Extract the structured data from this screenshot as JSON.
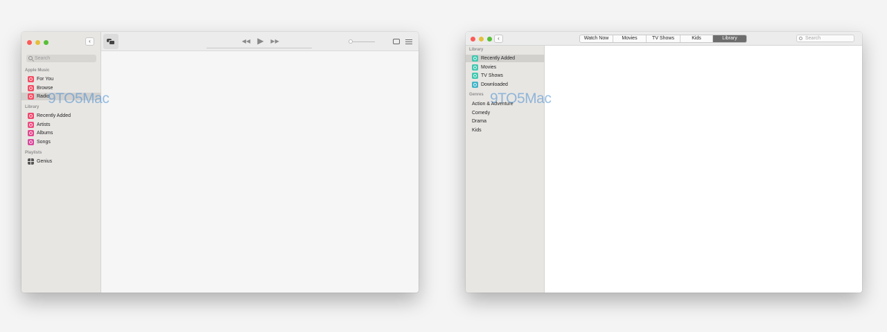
{
  "music_window": {
    "search_placeholder": "Search",
    "sections": [
      {
        "heading": "Apple Music",
        "items": [
          {
            "label": "For You",
            "icon": "heart-icon",
            "color": "#f34d64"
          },
          {
            "label": "Browse",
            "icon": "music-note-icon",
            "color": "#f34d64"
          },
          {
            "label": "Radio",
            "icon": "radio-icon",
            "color": "#f34d64",
            "selected": true
          }
        ]
      },
      {
        "heading": "Library",
        "items": [
          {
            "label": "Recently Added",
            "icon": "clock-icon",
            "color": "#f0466d"
          },
          {
            "label": "Artists",
            "icon": "microphone-icon",
            "color": "#ee4b80"
          },
          {
            "label": "Albums",
            "icon": "album-icon",
            "color": "#e2478c"
          },
          {
            "label": "Songs",
            "icon": "music-note-icon",
            "color": "#d8479b"
          }
        ]
      },
      {
        "heading": "Playlists",
        "items": [
          {
            "label": "Genius",
            "icon": "grid-icon",
            "color": "#555555"
          }
        ]
      }
    ],
    "transport": {
      "rewind": "◀◀",
      "play": "▶",
      "forward": "▶▶"
    }
  },
  "tv_window": {
    "tabs": [
      {
        "label": "Watch Now",
        "active": false
      },
      {
        "label": "Movies",
        "active": false
      },
      {
        "label": "TV Shows",
        "active": false
      },
      {
        "label": "Kids",
        "active": false
      },
      {
        "label": "Library",
        "active": true
      }
    ],
    "search_placeholder": "Search",
    "library_heading": "Library",
    "library_items": [
      {
        "label": "Recently Added",
        "icon": "clock-icon",
        "color": "#41c7b0",
        "selected": true
      },
      {
        "label": "Movies",
        "icon": "film-icon",
        "color": "#41c7b0"
      },
      {
        "label": "TV Shows",
        "icon": "tv-icon",
        "color": "#41c7b0"
      },
      {
        "label": "Downloaded",
        "icon": "download-icon",
        "color": "#41b3c7"
      }
    ],
    "genres_heading": "Genres",
    "genres": [
      "Action & Adventure",
      "Comedy",
      "Drama",
      "Kids"
    ]
  },
  "watermark": "9TO5Mac",
  "colors": {
    "close": "#fc5b57",
    "minimize": "#e5bf3c",
    "zoom": "#57c038"
  }
}
